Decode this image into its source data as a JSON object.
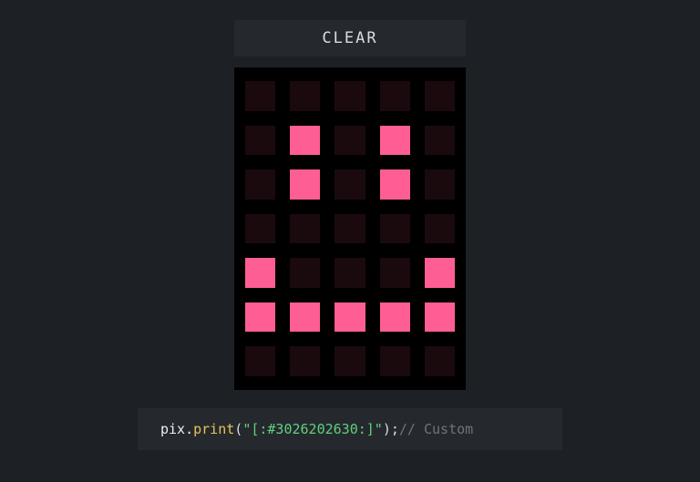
{
  "clear_label": "CLEAR",
  "colors": {
    "on": "#ff5e94",
    "off": "#1a0a0e",
    "grid_bg": "#000000"
  },
  "grid": {
    "cols": 5,
    "rows": 7,
    "cells": [
      [
        0,
        0,
        0,
        0,
        0
      ],
      [
        0,
        1,
        0,
        1,
        0
      ],
      [
        0,
        1,
        0,
        1,
        0
      ],
      [
        0,
        0,
        0,
        0,
        0
      ],
      [
        1,
        0,
        0,
        0,
        1
      ],
      [
        1,
        1,
        1,
        1,
        1
      ],
      [
        0,
        0,
        0,
        0,
        0
      ]
    ]
  },
  "code": {
    "obj": "pix",
    "dot": ".",
    "fn": "print",
    "open": "( ",
    "str": "\"[:#3026202630:]\"",
    "close": " );",
    "comment": " // Custom"
  }
}
